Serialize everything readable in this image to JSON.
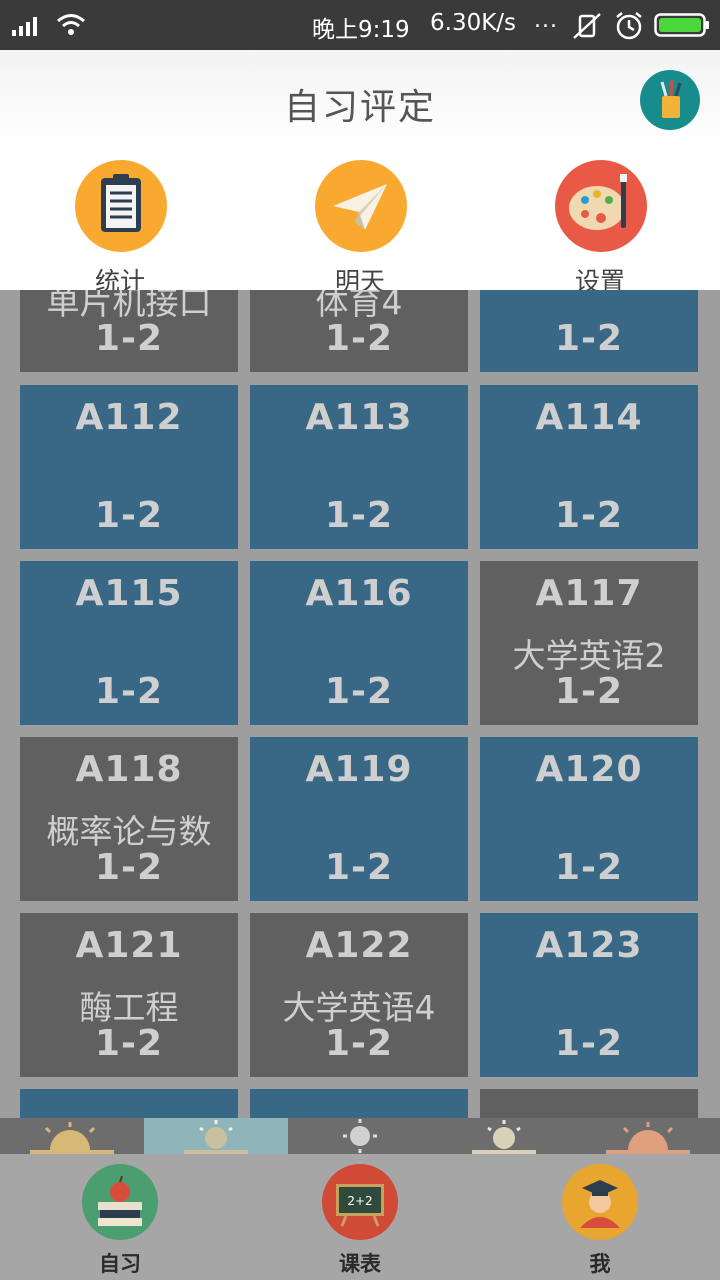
{
  "status_bar": {
    "time": "晚上9:19",
    "speed": "6.30K/s",
    "more": "...",
    "icons": [
      "signal-icon",
      "wifi-icon",
      "mute-icon",
      "alarm-icon",
      "battery-icon"
    ]
  },
  "header": {
    "title": "自习评定",
    "avatar_icon": "pencil-cup-icon",
    "avatar_color": "#178c8c"
  },
  "top_tabs": [
    {
      "label": "统计",
      "icon": "clipboard-icon",
      "color": "#f9a930"
    },
    {
      "label": "明天",
      "icon": "paper-plane-icon",
      "color": "#f9a930"
    },
    {
      "label": "设置",
      "icon": "palette-icon",
      "color": "#e85a45"
    }
  ],
  "grid": {
    "colors": {
      "free": "#386886",
      "occupied": "#606060"
    },
    "rows": [
      [
        {
          "room": "",
          "course": "单片机接口",
          "period": "1-2",
          "status": "occupied"
        },
        {
          "room": "",
          "course": "体育4",
          "period": "1-2",
          "status": "occupied"
        },
        {
          "room": "",
          "course": "",
          "period": "1-2",
          "status": "free"
        }
      ],
      [
        {
          "room": "A112",
          "course": "",
          "period": "1-2",
          "status": "free"
        },
        {
          "room": "A113",
          "course": "",
          "period": "1-2",
          "status": "free"
        },
        {
          "room": "A114",
          "course": "",
          "period": "1-2",
          "status": "free"
        }
      ],
      [
        {
          "room": "A115",
          "course": "",
          "period": "1-2",
          "status": "free"
        },
        {
          "room": "A116",
          "course": "",
          "period": "1-2",
          "status": "free"
        },
        {
          "room": "A117",
          "course": "大学英语2",
          "period": "1-2",
          "status": "occupied"
        }
      ],
      [
        {
          "room": "A118",
          "course": "概率论与数",
          "period": "1-2",
          "status": "occupied"
        },
        {
          "room": "A119",
          "course": "",
          "period": "1-2",
          "status": "free"
        },
        {
          "room": "A120",
          "course": "",
          "period": "1-2",
          "status": "free"
        }
      ],
      [
        {
          "room": "A121",
          "course": "酶工程",
          "period": "1-2",
          "status": "occupied"
        },
        {
          "room": "A122",
          "course": "大学英语4",
          "period": "1-2",
          "status": "occupied"
        },
        {
          "room": "A123",
          "course": "",
          "period": "1-2",
          "status": "free"
        }
      ],
      [
        {
          "room": "",
          "course": "",
          "period": "",
          "status": "free"
        },
        {
          "room": "",
          "course": "",
          "period": "",
          "status": "free"
        },
        {
          "room": "",
          "course": "",
          "period": "",
          "status": "occupied"
        }
      ]
    ]
  },
  "time_strip": [
    {
      "icon": "sunrise-icon",
      "bg": "#6d6d6d",
      "sun": "#d8b877"
    },
    {
      "icon": "morning-sun-icon",
      "bg": "#8fb4b9",
      "sun": "#c9c0a0"
    },
    {
      "icon": "noon-sun-icon",
      "bg": "#6d6d6d",
      "sun": "#d0d0d0"
    },
    {
      "icon": "afternoon-sun-icon",
      "bg": "#6d6d6d",
      "sun": "#d9d0b8"
    },
    {
      "icon": "sunset-icon",
      "bg": "#6d6d6d",
      "sun": "#e0a07e"
    }
  ],
  "bottom_nav": [
    {
      "label": "自习",
      "icon": "books-apple-icon",
      "color": "#4b9e70"
    },
    {
      "label": "课表",
      "icon": "blackboard-icon",
      "color": "#d14a36"
    },
    {
      "label": "我",
      "icon": "graduate-icon",
      "color": "#e8a530"
    }
  ]
}
